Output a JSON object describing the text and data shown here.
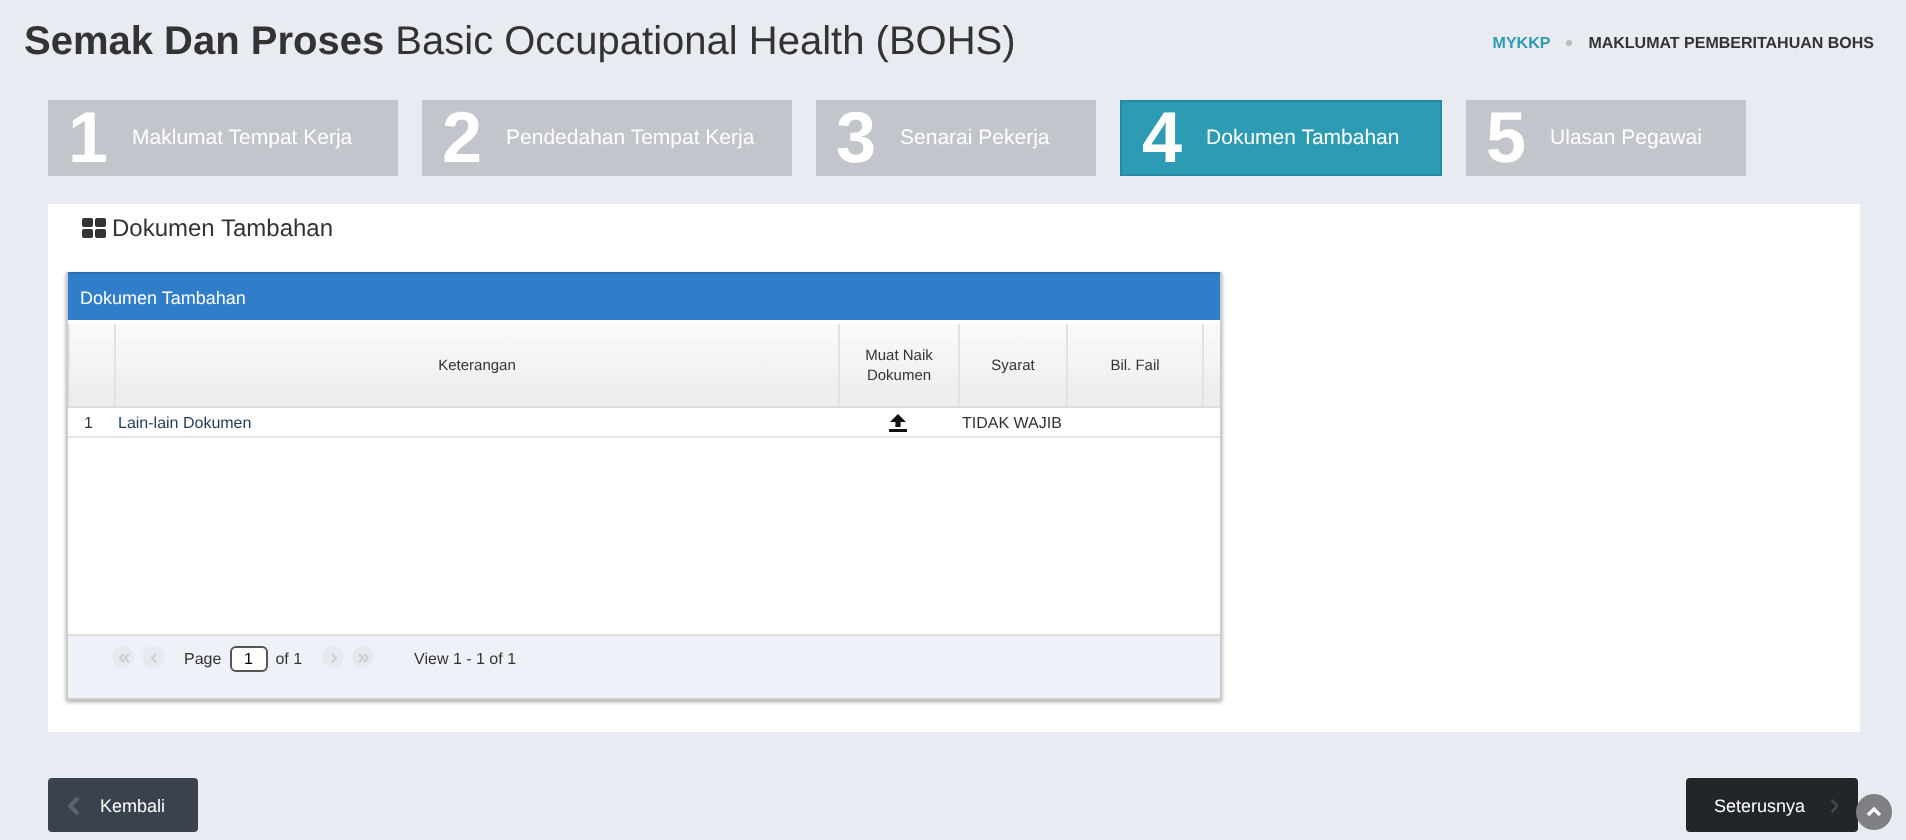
{
  "header": {
    "title_bold": "Semak Dan Proses",
    "title_rest": "Basic Occupational Health (BOHS)"
  },
  "breadcrumb": [
    {
      "label": "MYKKP",
      "kind": "link"
    },
    {
      "label": "MAKLUMAT PEMBERITAHUAN BOHS",
      "kind": "current"
    }
  ],
  "steps": [
    {
      "number": "1",
      "label": "Maklumat Tempat Kerja",
      "selected": false
    },
    {
      "number": "2",
      "label": "Pendedahan Tempat Kerja",
      "selected": false
    },
    {
      "number": "3",
      "label": "Senarai Pekerja",
      "selected": false
    },
    {
      "number": "4",
      "label": "Dokumen Tambahan",
      "selected": true
    },
    {
      "number": "5",
      "label": "Ulasan Pegawai",
      "selected": false
    }
  ],
  "panel": {
    "title": "Dokumen Tambahan"
  },
  "grid": {
    "caption": "Dokumen Tambahan",
    "columns": [
      "Keterangan",
      "Muat Naik Dokumen",
      "Syarat",
      "Bil. Fail"
    ],
    "rows": [
      {
        "number": "1",
        "keterangan": "Lain-lain Dokumen",
        "upload": true,
        "syarat": "TIDAK WAJIB",
        "bil_fail": ""
      }
    ],
    "pager": {
      "page_label": "Page",
      "page_value": "1",
      "of_label": "of 1",
      "view": "View 1 - 1 of 1"
    }
  },
  "buttons": {
    "back": "Kembali",
    "next": "Seterusnya"
  }
}
